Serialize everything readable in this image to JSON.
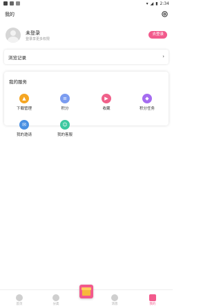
{
  "status_bar": {
    "time": "2:34"
  },
  "header": {
    "title": "我的",
    "settings_icon": "gear-icon"
  },
  "profile": {
    "name": "未登录",
    "subtitle": "登录享更多权限",
    "login_button": "去登录"
  },
  "history": {
    "label": "浏览记录"
  },
  "services": {
    "title": "我的服务",
    "items": [
      {
        "label": "下载管理",
        "icon": "download-icon",
        "color": "#f5a623"
      },
      {
        "label": "积分",
        "icon": "points-icon",
        "color": "#7b9cf0"
      },
      {
        "label": "收藏",
        "icon": "favorite-icon",
        "color": "#f0608a"
      },
      {
        "label": "积分任务",
        "icon": "task-icon",
        "color": "#a56cf0"
      },
      {
        "label": "我的邀请",
        "icon": "invite-icon",
        "color": "#4a90e2"
      },
      {
        "label": "我的客服",
        "icon": "service-icon",
        "color": "#3cc8a0"
      }
    ]
  },
  "nav": {
    "items": [
      {
        "label": "首页"
      },
      {
        "label": "分类"
      },
      {
        "label": "消息"
      },
      {
        "label": "我的"
      }
    ]
  },
  "colors": {
    "accent": "#f25a8c"
  }
}
